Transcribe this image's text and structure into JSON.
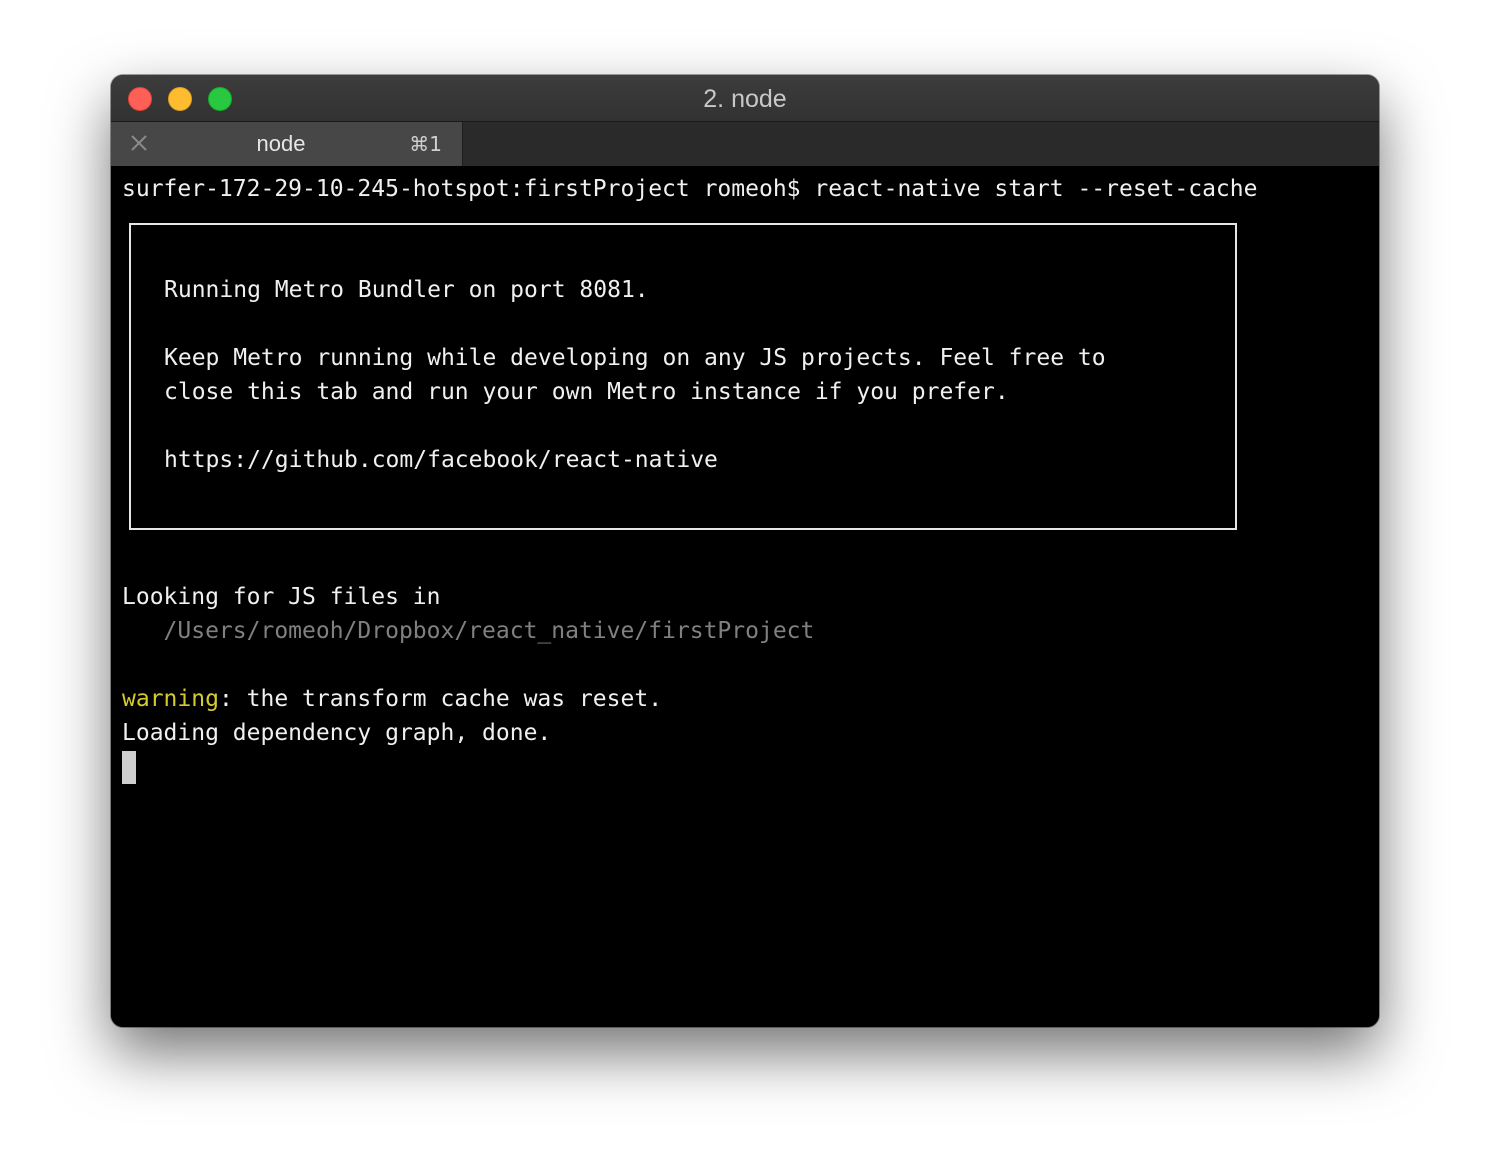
{
  "window": {
    "title": "2. node",
    "traffic_lights": {
      "close_color": "#fe5f57",
      "minimize_color": "#febc2e",
      "zoom_color": "#28c840"
    }
  },
  "tabs": [
    {
      "label": "node",
      "shortcut": "⌘1",
      "close_icon": "close-icon"
    }
  ],
  "terminal": {
    "prompt_line": "surfer-172-29-10-245-hotspot:firstProject romeoh$ react-native start --reset-cache",
    "box": {
      "line1": "Running Metro Bundler on port 8081.",
      "line2": "Keep Metro running while developing on any JS projects. Feel free to",
      "line3": "close this tab and run your own Metro instance if you prefer.",
      "line4": "https://github.com/facebook/react-native"
    },
    "looking_line": "Looking for JS files in",
    "path_line": "   /Users/romeoh/Dropbox/react_native/firstProject",
    "warning_keyword": "warning",
    "warning_rest": ": the transform cache was reset.",
    "loading_line": "Loading dependency graph, done.",
    "colors": {
      "warning": "#d4cc2e",
      "path": "#808080",
      "text": "#f0f0f0",
      "background": "#000000"
    }
  }
}
